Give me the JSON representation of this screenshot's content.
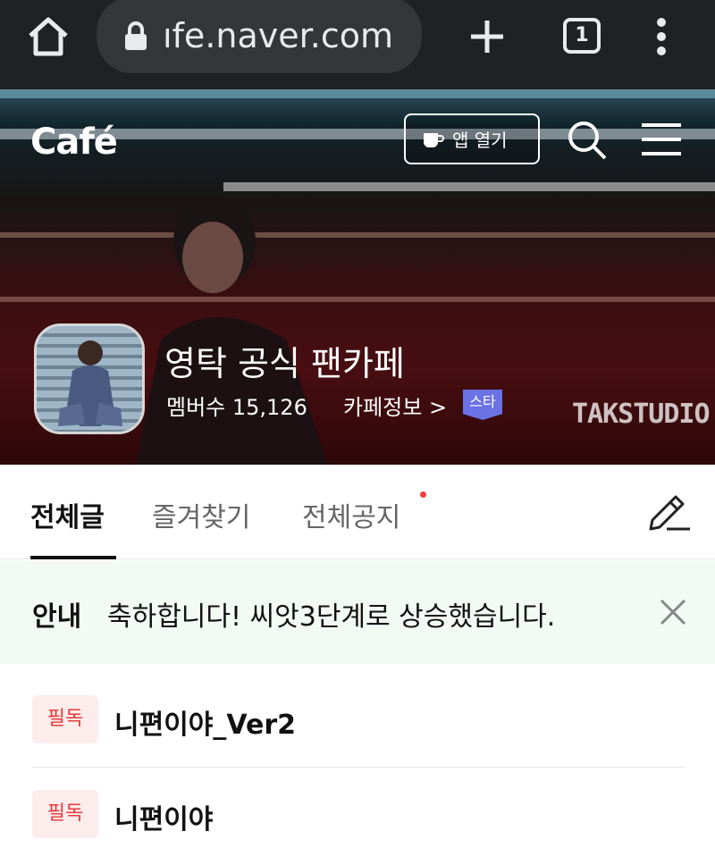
{
  "browser": {
    "url_text": "ıfe.naver.com",
    "tab_count": "1"
  },
  "header": {
    "logo": "Café",
    "app_open_label": "앱 열기"
  },
  "cafe": {
    "name": "영탁 공식 팬카페",
    "members": "멤버수 15,126",
    "info_link": "카페정보 >",
    "badge": "스타",
    "watermark": "TAKSTUDIO"
  },
  "tabs": [
    {
      "label": "전체글",
      "active": true
    },
    {
      "label": "즐겨찾기",
      "active": false
    },
    {
      "label": "전체공지",
      "active": false,
      "new_dot": true
    }
  ],
  "notice": {
    "label": "안내",
    "text": "축하합니다! 씨앗3단계로 상승했습니다."
  },
  "posts": [
    {
      "badge": "필독",
      "title": "니편이야_Ver2"
    },
    {
      "badge": "필독",
      "title": "니편이야"
    }
  ],
  "colors": {
    "browser_bg": "#202124",
    "badge_red": "#e83b3b",
    "star_badge": "#6a72e6",
    "notice_bg": "#f3faf4"
  }
}
